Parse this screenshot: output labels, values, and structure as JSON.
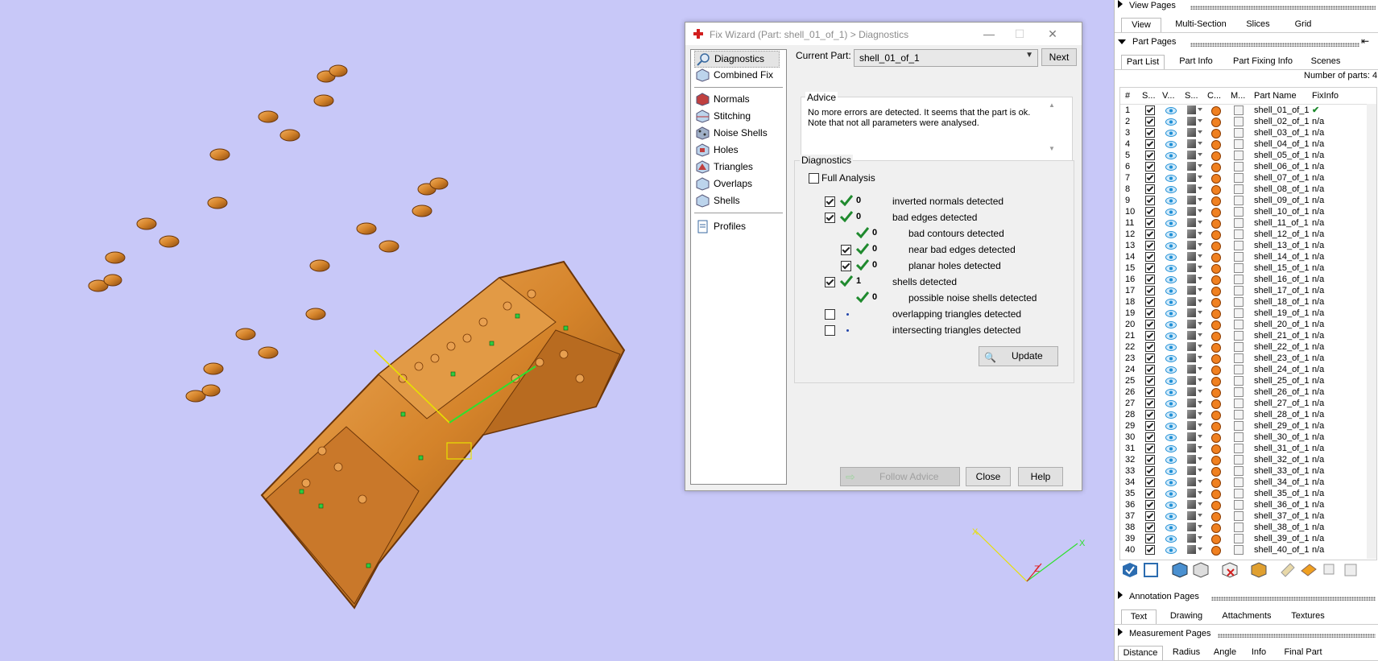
{
  "dialog": {
    "title": "Fix Wizard (Part: shell_01_of_1) > Diagnostics",
    "nav_items": [
      {
        "label": "Diagnostics",
        "icon": "magnifier-icon"
      },
      {
        "label": "Combined Fix",
        "icon": "cube-icon"
      },
      {
        "label": "Normals",
        "icon": "normals-cube-icon"
      },
      {
        "label": "Stitching",
        "icon": "stitching-cube-icon"
      },
      {
        "label": "Noise Shells",
        "icon": "noise-shells-icon"
      },
      {
        "label": "Holes",
        "icon": "holes-cube-icon"
      },
      {
        "label": "Triangles",
        "icon": "triangles-cube-icon"
      },
      {
        "label": "Overlaps",
        "icon": "overlaps-cube-icon"
      },
      {
        "label": "Shells",
        "icon": "shells-cube-icon"
      },
      {
        "label": "Profiles",
        "icon": "document-icon"
      }
    ],
    "current_part_label": "Current Part:",
    "current_part_value": "shell_01_of_1",
    "next_label": "Next",
    "advice_label": "Advice",
    "advice_line1": "No more errors are detected. It seems that the part is ok.",
    "advice_line2": "Note that not all parameters were analysed.",
    "diagnostics_label": "Diagnostics",
    "full_analysis_label": "Full Analysis",
    "rows": [
      {
        "value": "0",
        "label": "inverted normals detected"
      },
      {
        "value": "0",
        "label": "bad edges detected"
      },
      {
        "value": "0",
        "label": "bad contours detected"
      },
      {
        "value": "0",
        "label": "near bad edges detected"
      },
      {
        "value": "0",
        "label": "planar holes detected"
      },
      {
        "value": "1",
        "label": "shells detected"
      },
      {
        "value": "0",
        "label": "possible noise shells detected"
      },
      {
        "value": "",
        "label": "overlapping triangles detected"
      },
      {
        "value": "",
        "label": "intersecting triangles detected"
      }
    ],
    "update_label": "Update",
    "follow_advice_label": "Follow Advice",
    "close_label": "Close",
    "help_label": "Help"
  },
  "panel": {
    "view_pages": "View Pages",
    "view_tabs": [
      "View",
      "Multi-Section",
      "Slices",
      "Grid"
    ],
    "part_pages": "Part Pages",
    "part_tabs": [
      "Part List",
      "Part Info",
      "Part Fixing Info",
      "Scenes"
    ],
    "number_of_parts": "Number of parts: 4",
    "headers": [
      "#",
      "S...",
      "V...",
      "S...",
      "C...",
      "M...",
      "Part Name",
      "FixInfo"
    ],
    "parts": [
      {
        "n": "1",
        "name": "shell_01_of_1",
        "fix": "✔"
      },
      {
        "n": "2",
        "name": "shell_02_of_1",
        "fix": "n/a"
      },
      {
        "n": "3",
        "name": "shell_03_of_1",
        "fix": "n/a"
      },
      {
        "n": "4",
        "name": "shell_04_of_1",
        "fix": "n/a"
      },
      {
        "n": "5",
        "name": "shell_05_of_1",
        "fix": "n/a"
      },
      {
        "n": "6",
        "name": "shell_06_of_1",
        "fix": "n/a"
      },
      {
        "n": "7",
        "name": "shell_07_of_1",
        "fix": "n/a"
      },
      {
        "n": "8",
        "name": "shell_08_of_1",
        "fix": "n/a"
      },
      {
        "n": "9",
        "name": "shell_09_of_1",
        "fix": "n/a"
      },
      {
        "n": "10",
        "name": "shell_10_of_1",
        "fix": "n/a"
      },
      {
        "n": "11",
        "name": "shell_11_of_1",
        "fix": "n/a"
      },
      {
        "n": "12",
        "name": "shell_12_of_1",
        "fix": "n/a"
      },
      {
        "n": "13",
        "name": "shell_13_of_1",
        "fix": "n/a"
      },
      {
        "n": "14",
        "name": "shell_14_of_1",
        "fix": "n/a"
      },
      {
        "n": "15",
        "name": "shell_15_of_1",
        "fix": "n/a"
      },
      {
        "n": "16",
        "name": "shell_16_of_1",
        "fix": "n/a"
      },
      {
        "n": "17",
        "name": "shell_17_of_1",
        "fix": "n/a"
      },
      {
        "n": "18",
        "name": "shell_18_of_1",
        "fix": "n/a"
      },
      {
        "n": "19",
        "name": "shell_19_of_1",
        "fix": "n/a"
      },
      {
        "n": "20",
        "name": "shell_20_of_1",
        "fix": "n/a"
      },
      {
        "n": "21",
        "name": "shell_21_of_1",
        "fix": "n/a"
      },
      {
        "n": "22",
        "name": "shell_22_of_1",
        "fix": "n/a"
      },
      {
        "n": "23",
        "name": "shell_23_of_1",
        "fix": "n/a"
      },
      {
        "n": "24",
        "name": "shell_24_of_1",
        "fix": "n/a"
      },
      {
        "n": "25",
        "name": "shell_25_of_1",
        "fix": "n/a"
      },
      {
        "n": "26",
        "name": "shell_26_of_1",
        "fix": "n/a"
      },
      {
        "n": "27",
        "name": "shell_27_of_1",
        "fix": "n/a"
      },
      {
        "n": "28",
        "name": "shell_28_of_1",
        "fix": "n/a"
      },
      {
        "n": "29",
        "name": "shell_29_of_1",
        "fix": "n/a"
      },
      {
        "n": "30",
        "name": "shell_30_of_1",
        "fix": "n/a"
      },
      {
        "n": "31",
        "name": "shell_31_of_1",
        "fix": "n/a"
      },
      {
        "n": "32",
        "name": "shell_32_of_1",
        "fix": "n/a"
      },
      {
        "n": "33",
        "name": "shell_33_of_1",
        "fix": "n/a"
      },
      {
        "n": "34",
        "name": "shell_34_of_1",
        "fix": "n/a"
      },
      {
        "n": "35",
        "name": "shell_35_of_1",
        "fix": "n/a"
      },
      {
        "n": "36",
        "name": "shell_36_of_1",
        "fix": "n/a"
      },
      {
        "n": "37",
        "name": "shell_37_of_1",
        "fix": "n/a"
      },
      {
        "n": "38",
        "name": "shell_38_of_1",
        "fix": "n/a"
      },
      {
        "n": "39",
        "name": "shell_39_of_1",
        "fix": "n/a"
      },
      {
        "n": "40",
        "name": "shell_40_of_1",
        "fix": "n/a"
      }
    ],
    "annotation_pages": "Annotation Pages",
    "annotation_tabs": [
      "Text",
      "Drawing",
      "Attachments",
      "Textures"
    ],
    "measurement_pages": "Measurement Pages",
    "measurement_tabs": [
      "Distance",
      "Radius",
      "Angle",
      "Info",
      "Final Part"
    ]
  },
  "colors": {
    "viewport_bg": "#c8c8f8",
    "part_orange": "#d98a2b",
    "accent_green": "#1f8a2e"
  }
}
